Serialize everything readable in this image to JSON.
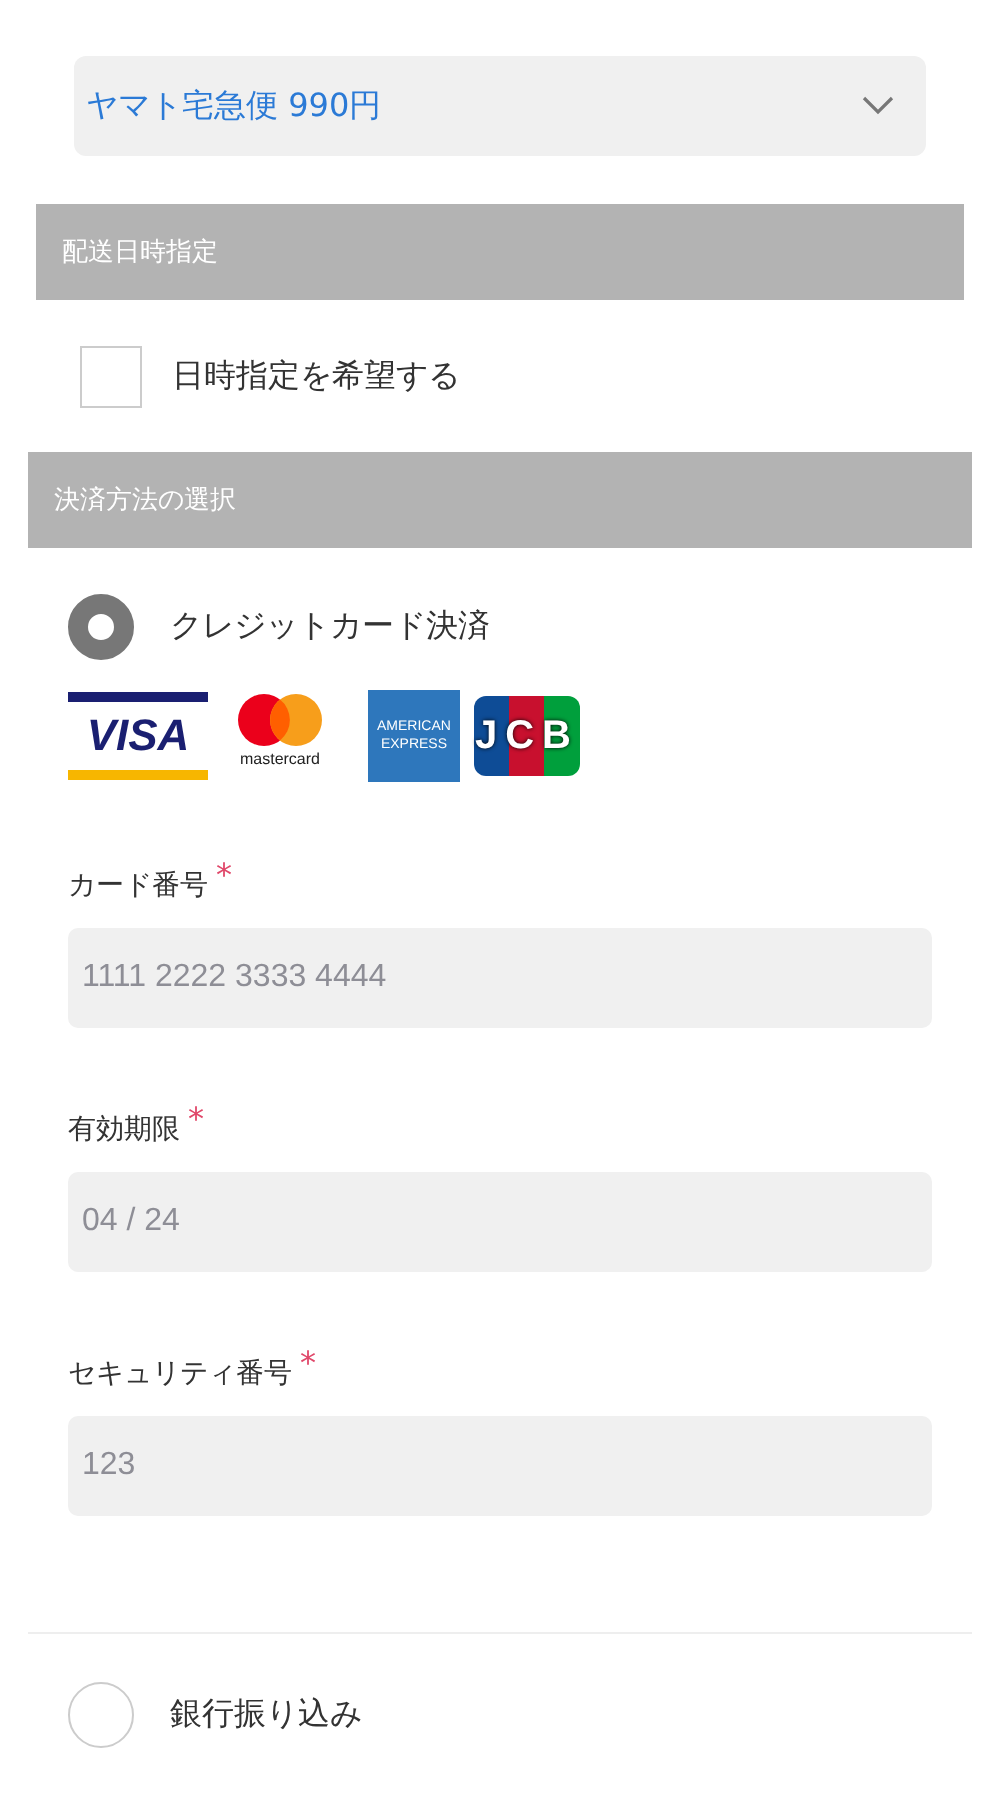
{
  "shipping_select": {
    "value": "ヤマト宅急便 990円"
  },
  "delivery_section": {
    "title": "配送日時指定",
    "option": {
      "label": "日時指定を希望する",
      "checked": false
    }
  },
  "payment_section": {
    "title": "決済方法の選択"
  },
  "payment_methods": [
    {
      "kind": "credit",
      "label": "クレジットカード決済",
      "selected": true,
      "brands": [
        {
          "kind": "visa",
          "text": "VISA"
        },
        {
          "kind": "mastercard",
          "text": "mastercard"
        },
        {
          "kind": "amex",
          "text": "AMERICAN EXPRESS"
        },
        {
          "kind": "jcb",
          "text": "JCB"
        }
      ],
      "fields": [
        {
          "label": "カード番号",
          "required_mark": "*",
          "placeholder": "1111 2222 3333 4444"
        },
        {
          "label": "有効期限",
          "required_mark": "*",
          "placeholder": "04 / 24"
        },
        {
          "label": "セキュリティ番号",
          "required_mark": "*",
          "placeholder": "123"
        }
      ]
    },
    {
      "kind": "bank",
      "label": "銀行振り込み",
      "selected": false
    }
  ]
}
